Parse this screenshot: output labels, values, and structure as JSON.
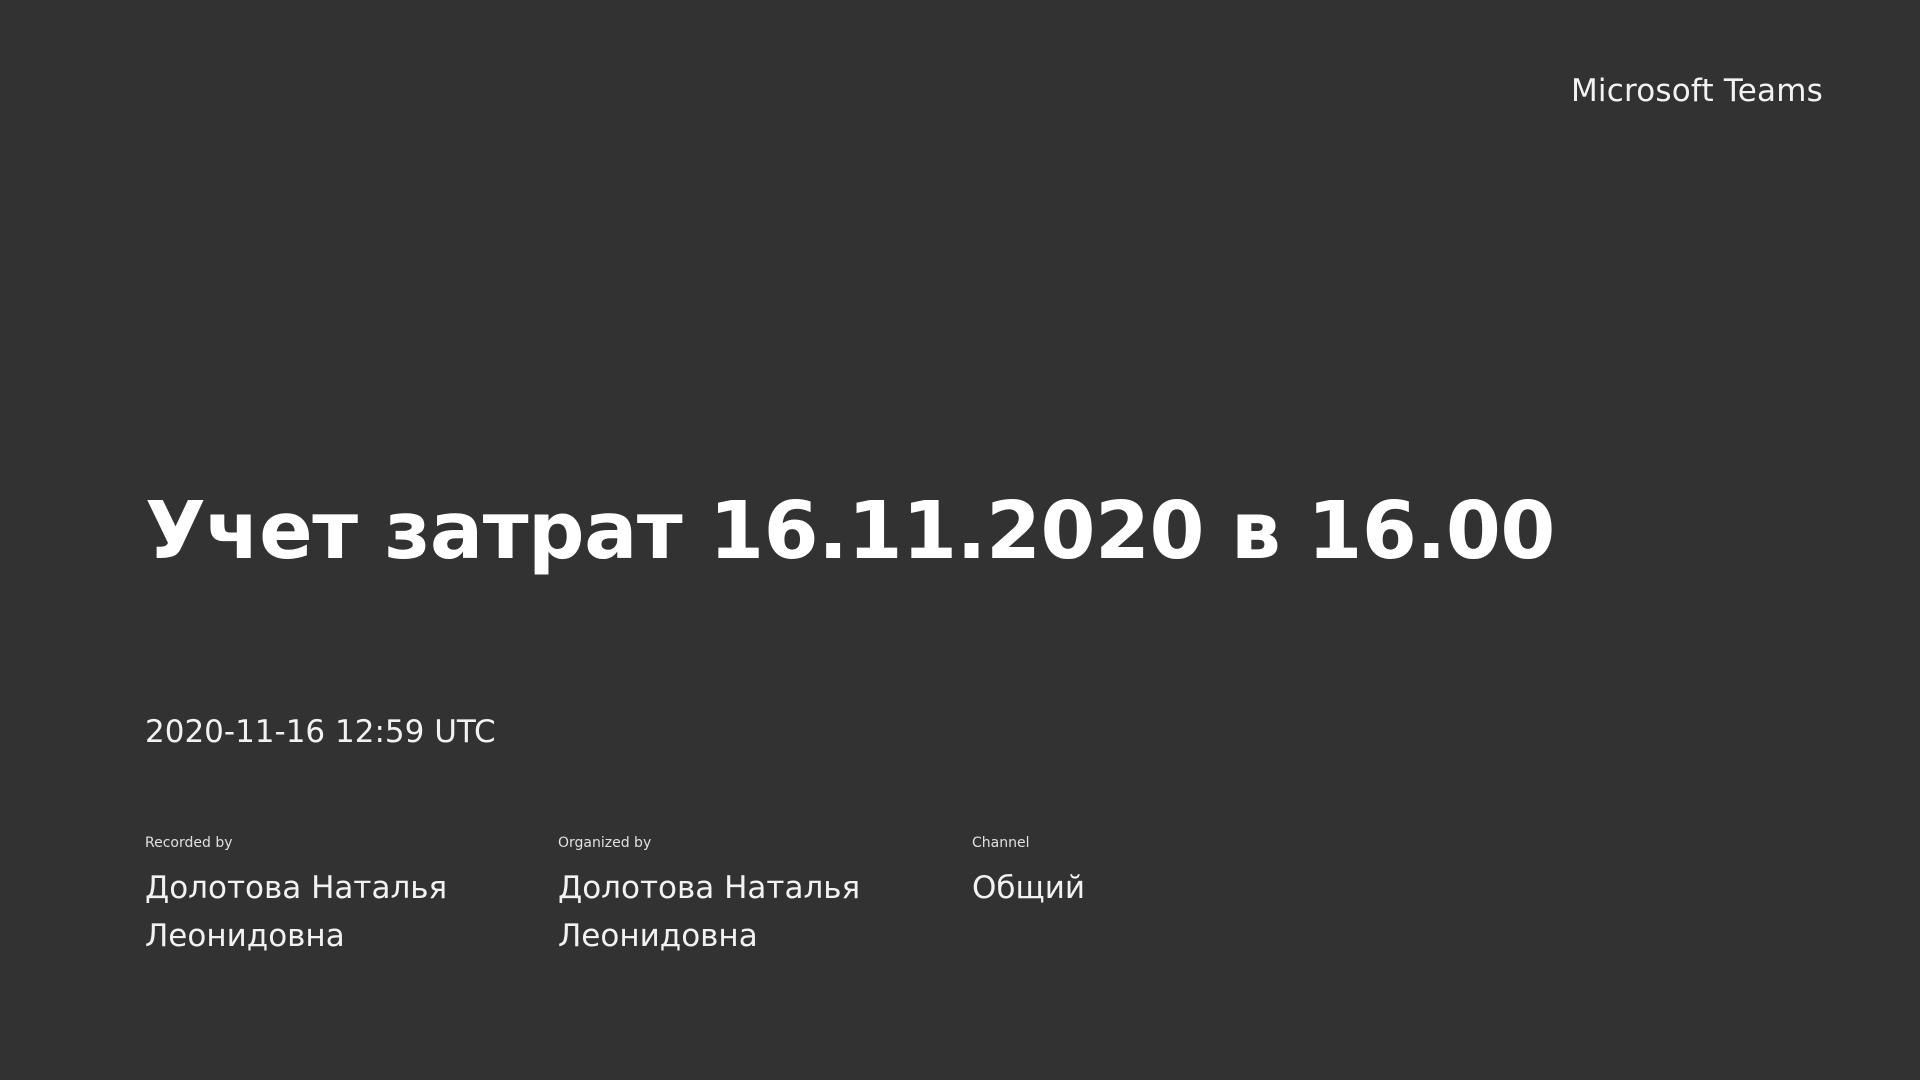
{
  "brand": "Microsoft Teams",
  "meeting": {
    "title": "Учет затрат 16.11.2020 в 16.00",
    "datetime": "2020-11-16 12:59 UTC"
  },
  "details": {
    "recorded_by": {
      "label": "Recorded by",
      "value": "Долотова Наталья Леонидовна"
    },
    "organized_by": {
      "label": "Organized by",
      "value": "Долотова Наталья Леонидовна"
    },
    "channel": {
      "label": "Channel",
      "value": "Общий"
    }
  },
  "colors": {
    "background": "#323232",
    "text": "#ffffff"
  }
}
